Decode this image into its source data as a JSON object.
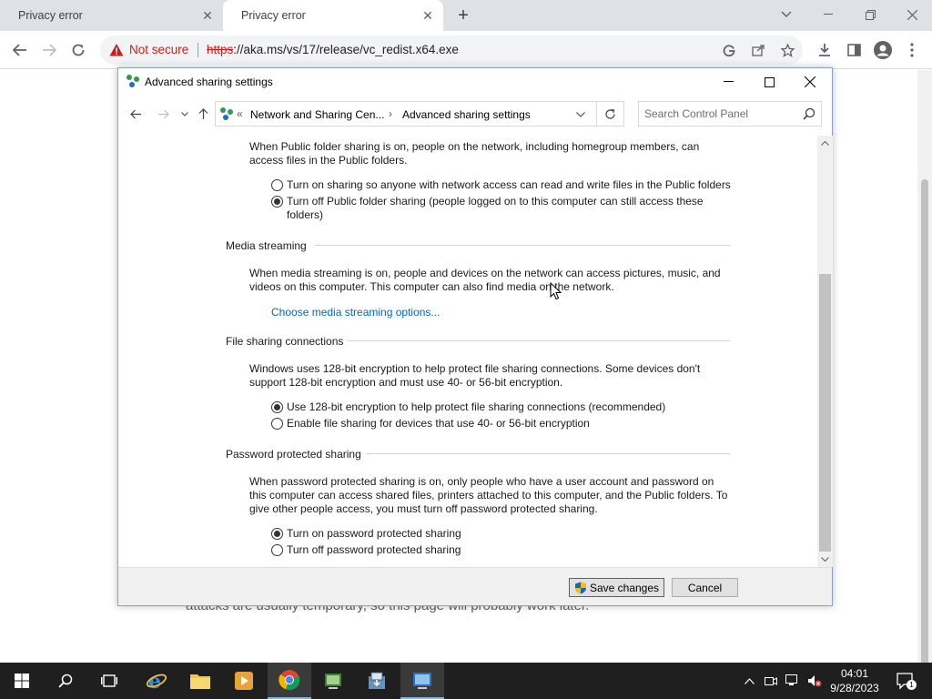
{
  "browser": {
    "tabs": [
      {
        "title": "Privacy error",
        "close": "✕"
      },
      {
        "title": "Privacy error",
        "close": "✕"
      }
    ],
    "new_tab": "+",
    "security_label": "Not secure",
    "url_scheme": "https",
    "url_rest": "://aka.ms/vs/17/release/vc_redist.x64.exe",
    "page_text": "attacks are usually temporary, so this page will probably work later."
  },
  "dialog": {
    "title": "Advanced sharing settings",
    "breadcrumb": {
      "prefix": "«",
      "items": [
        "Network and Sharing Cen...",
        "Advanced sharing settings"
      ],
      "separator": "›"
    },
    "search_placeholder": "Search Control Panel",
    "public_folder": {
      "description": "When Public folder sharing is on, people on the network, including homegroup members, can access files in the Public folders.",
      "options": [
        {
          "label": "Turn on sharing so anyone with network access can read and write files in the Public folders",
          "selected": false
        },
        {
          "label": "Turn off Public folder sharing (people logged on to this computer can still access these folders)",
          "selected": true
        }
      ]
    },
    "media_streaming": {
      "heading": "Media streaming",
      "description": "When media streaming is on, people and devices on the network can access pictures, music, and videos on this computer. This computer can also find media on the network.",
      "link": "Choose media streaming options..."
    },
    "file_sharing": {
      "heading": "File sharing connections",
      "description": "Windows uses 128-bit encryption to help protect file sharing connections. Some devices don't support 128-bit encryption and must use 40- or 56-bit encryption.",
      "options": [
        {
          "label": "Use 128-bit encryption to help protect file sharing connections (recommended)",
          "selected": true
        },
        {
          "label": "Enable file sharing for devices that use 40- or 56-bit encryption",
          "selected": false
        }
      ]
    },
    "password_sharing": {
      "heading": "Password protected sharing",
      "description": "When password protected sharing is on, only people who have a user account and password on this computer can access shared files, printers attached to this computer, and the Public folders. To give other people access, you must turn off password protected sharing.",
      "options": [
        {
          "label": "Turn on password protected sharing",
          "selected": true
        },
        {
          "label": "Turn off password protected sharing",
          "selected": false
        }
      ]
    },
    "buttons": {
      "save": "Save changes",
      "cancel": "Cancel"
    }
  },
  "taskbar": {
    "time": "04:01",
    "date": "9/28/2023",
    "notification_count": "1"
  }
}
